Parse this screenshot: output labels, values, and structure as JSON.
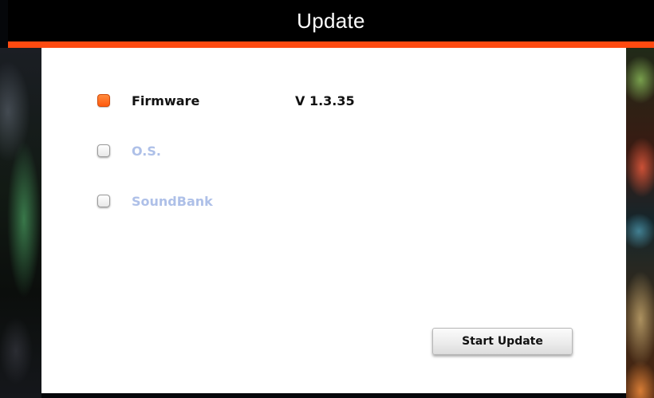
{
  "header": {
    "title": "Update"
  },
  "options": [
    {
      "label": "Firmware",
      "version": "V 1.3.35",
      "checked": true,
      "enabled": true
    },
    {
      "label": "O.S.",
      "checked": false,
      "enabled": false
    },
    {
      "label": "SoundBank",
      "checked": false,
      "enabled": false
    }
  ],
  "actions": {
    "start_label": "Start Update"
  },
  "colors": {
    "accent": "#ff4a10",
    "checked": "#ff5a0e",
    "disabled_text": "#aec0e8"
  }
}
